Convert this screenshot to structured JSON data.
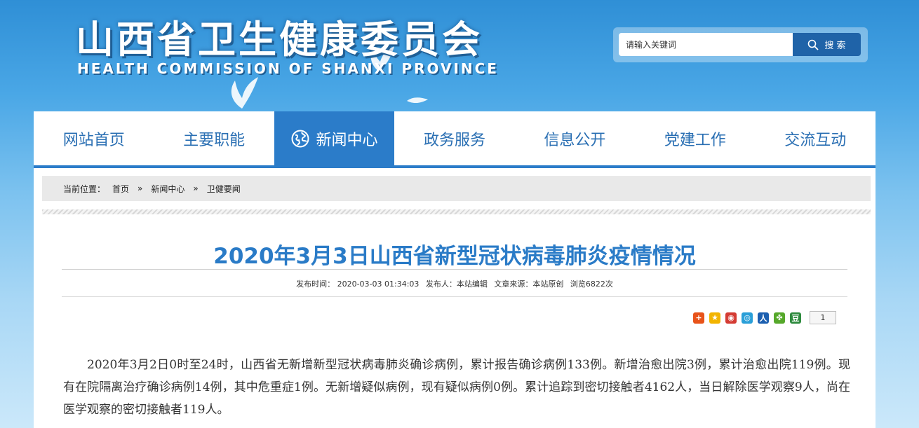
{
  "header": {
    "title": "山西省卫生健康委员会",
    "subtitle": "HEALTH COMMISSION OF SHANXI PROVINCE"
  },
  "search": {
    "placeholder": "请输入关键词",
    "button_label": "搜 索"
  },
  "nav": {
    "items": [
      {
        "label": "网站首页"
      },
      {
        "label": "主要职能"
      },
      {
        "label": "新闻中心"
      },
      {
        "label": "政务服务"
      },
      {
        "label": "信息公开"
      },
      {
        "label": "党建工作"
      },
      {
        "label": "交流互动"
      }
    ],
    "active_index": 2
  },
  "breadcrumb": {
    "prefix": "当前位置：",
    "items": [
      "首页",
      "新闻中心",
      "卫健要闻"
    ],
    "separator": "»"
  },
  "article": {
    "title": "2020年3月3日山西省新型冠状病毒肺炎疫情情况",
    "meta": {
      "publish_time": "发布时间： 2020-03-03 01:34:03",
      "publisher": "发布人：本站编辑",
      "source": "文章来源：本站原创",
      "views": "浏览6822次"
    },
    "body": "2020年3月2日0时至24时，山西省无新增新型冠状病毒肺炎确诊病例，累计报告确诊病例133例。新增治愈出院3例，累计治愈出院119例。现有在院隔离治疗确诊病例14例，其中危重症1例。无新增疑似病例，现有疑似病例0例。累计追踪到密切接触者4162人，当日解除医学观察9人，尚在医学观察的密切接触者119人。"
  },
  "share": {
    "count": "1",
    "icons": [
      {
        "name": "share-more-icon",
        "glyph": "+",
        "color": "#e8531a"
      },
      {
        "name": "qzone-icon",
        "glyph": "★",
        "color": "#f2b400"
      },
      {
        "name": "weibo-icon",
        "glyph": "◉",
        "color": "#d43b33"
      },
      {
        "name": "tencent-weibo-icon",
        "glyph": "◎",
        "color": "#2a9fd8"
      },
      {
        "name": "renren-icon",
        "glyph": "人",
        "color": "#1c5fb0"
      },
      {
        "name": "kaixin-icon",
        "glyph": "✤",
        "color": "#56a82b"
      },
      {
        "name": "douban-icon",
        "glyph": "豆",
        "color": "#2e8b3e"
      }
    ]
  }
}
